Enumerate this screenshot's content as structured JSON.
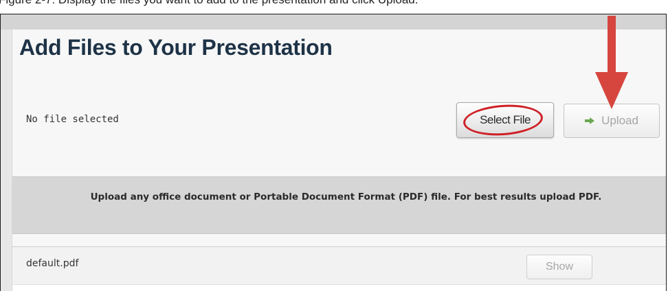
{
  "instruction_text": "Figure 2-7: Display the files you want to add to the presentation and click Upload.",
  "dialog": {
    "title": "Add Files to Your Presentation",
    "file_status": "No file selected",
    "select_file_label": "Select File",
    "upload_label": "Upload",
    "info_text": "Upload any office document or Portable Document Format (PDF) file.  For best results upload PDF.",
    "files": [
      {
        "name": "default.pdf",
        "action_label": "Show"
      }
    ]
  },
  "annotations": {
    "highlight_color": "#cf1f25",
    "arrow_target": "upload-button",
    "ring_target": "select-file-button"
  },
  "icons": {
    "upload": "green-arrow-right-icon",
    "annotation": "red-arrow-down-icon"
  },
  "colors": {
    "title": "#1e3347",
    "annotation_red": "#d6463f",
    "upload_arrow_green": "#6aa84f",
    "panel_bg": "#f7f7f7",
    "info_bg": "#d6d6d6"
  }
}
